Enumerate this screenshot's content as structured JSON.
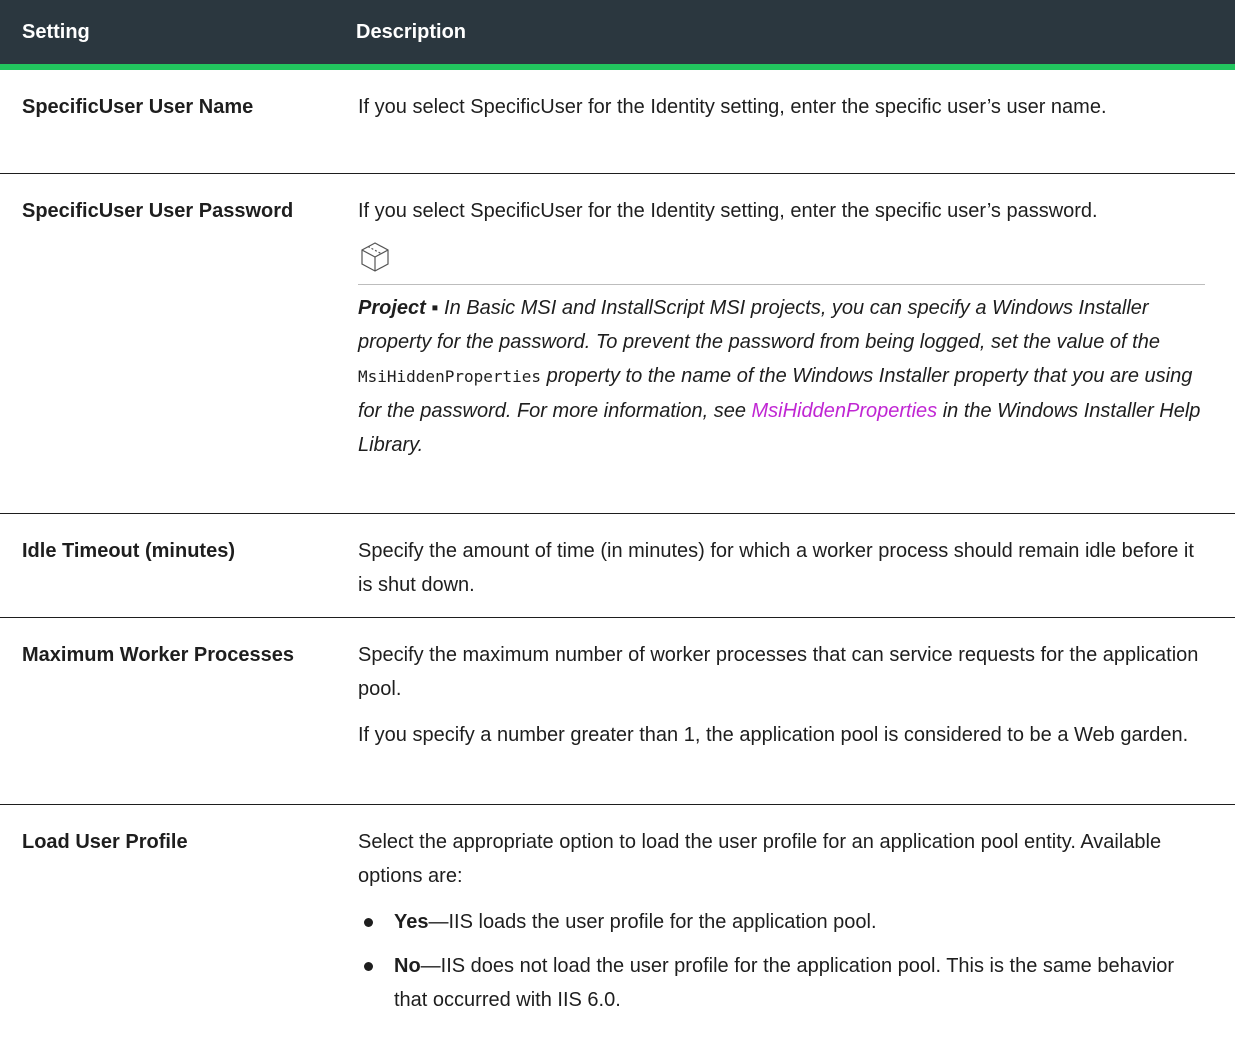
{
  "header": {
    "setting": "Setting",
    "description": "Description"
  },
  "rows": [
    {
      "setting": "SpecificUser User Name",
      "description": "If you select SpecificUser for the Identity setting, enter the specific user’s user name."
    },
    {
      "setting": "SpecificUser User Password",
      "description": "If you select SpecificUser for the Identity setting, enter the specific user’s password.",
      "note": {
        "icon": "project-box-icon",
        "label": "Project",
        "separator": " ▪ ",
        "text_1": "In Basic MSI and InstallScript MSI projects, you can specify a Windows Installer property for the password. To prevent the password from being logged, set the value of the ",
        "code": "MsiHiddenProperties",
        "text_2": " property to the name of the Windows Installer property that you are using for the password. For more information, see ",
        "link": "MsiHiddenProperties",
        "text_3": " in the Windows Installer Help Library."
      }
    },
    {
      "setting": "Idle Timeout (minutes)",
      "description": "Specify the amount of time (in minutes) for which a worker process should remain idle before it is shut down."
    },
    {
      "setting": "Maximum Worker Processes",
      "description": "Specify the maximum number of worker processes that can service requests for the application pool.",
      "description_2": "If you specify a number greater than 1, the application pool is considered to be a Web garden."
    },
    {
      "setting": "Load User Profile",
      "description": "Select the appropriate option to load the user profile for an application pool entity. Available options are:",
      "options": [
        {
          "term": "Yes",
          "text": "—IIS loads the user profile for the application pool."
        },
        {
          "term": "No",
          "text": "—IIS does not load the user profile for the application pool. This is the same behavior that occurred with IIS 6.0."
        }
      ]
    }
  ],
  "colors": {
    "header_bg": "#2b373f",
    "accent_green": "#22c55e",
    "link": "#c026d3"
  }
}
